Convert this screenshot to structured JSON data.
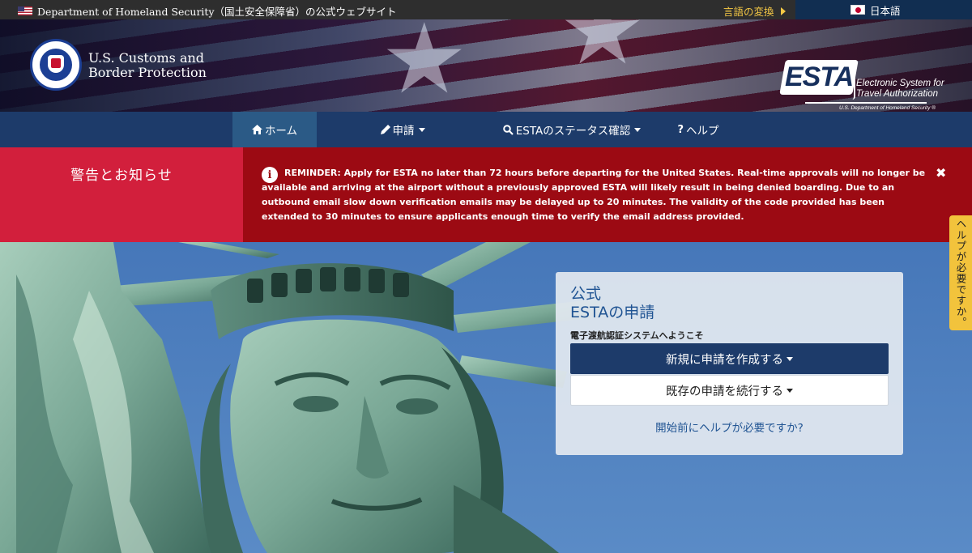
{
  "topbar": {
    "gov_text": "Department of Homeland Security（国土安全保障省）の公式ウェブサイト",
    "lang_switch": "言語の変換",
    "current_lang": "日本語"
  },
  "header": {
    "agency_line1": "U.S. Customs and",
    "agency_line2": "Border Protection",
    "esta_logo": "ESTA",
    "esta_sub_line1": "Electronic System for",
    "esta_sub_line2": "Travel Authorization",
    "esta_dhs": "U.S. Department of Homeland Security ®"
  },
  "nav": {
    "items": [
      {
        "icon": "home-icon",
        "label": "ホーム"
      },
      {
        "icon": "pencil-icon",
        "label": "申請"
      },
      {
        "icon": "search-icon",
        "label": "ESTAのステータス確認"
      },
      {
        "icon": "question-icon",
        "label": "ヘルプ"
      }
    ]
  },
  "alert": {
    "heading": "警告とお知らせ",
    "message": "REMINDER: Apply for ESTA no later than 72 hours before departing for the United States. Real-time approvals will no longer be available and arriving at the airport without a previously approved ESTA will likely result in being denied boarding. Due to an outbound email slow down verification emails may be delayed up to 20 minutes. The validity of the code provided has been extended to 30 minutes to ensure applicants enough time to verify the email address provided."
  },
  "card": {
    "title_line1": "公式",
    "title_line2": "ESTAの申請",
    "subtitle": "電子渡航認証システムへようこそ",
    "primary_button": "新規に申請を作成する",
    "secondary_button": "既存の申請を続行する",
    "help_link": "開始前にヘルプが必要ですか?"
  },
  "help_tab": "ヘルプが必要ですか。",
  "colors": {
    "nav_bg": "#1d3b6a",
    "alert_red": "#d21f3c",
    "alert_dark": "#9c0a13",
    "help_yellow": "#f2c33c"
  }
}
